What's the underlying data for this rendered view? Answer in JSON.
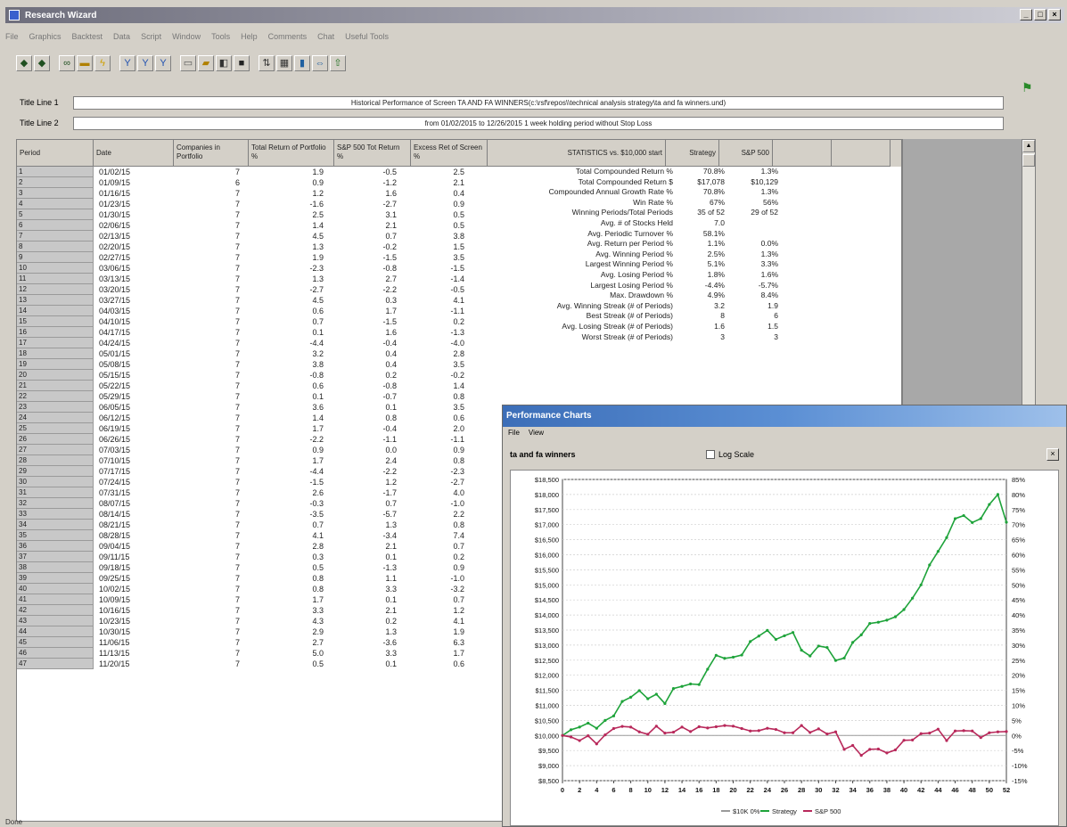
{
  "window": {
    "title": "Research Wizard",
    "min": "_",
    "max": "□",
    "close": "×"
  },
  "menu": [
    "File",
    "Graphics",
    "Backtest",
    "Data",
    "Script",
    "Window",
    "Tools",
    "Help",
    "Comments",
    "Chat",
    "Useful Tools"
  ],
  "toolbar_icons": [
    "back-icon",
    "forward-icon",
    "binoculars-icon",
    "minus-icon",
    "lightning-icon",
    "filter-icon",
    "filter-icon",
    "filter-icon",
    "new-icon",
    "open-icon",
    "preview-icon",
    "save-icon",
    "pivot-icon",
    "grid-icon",
    "chart-icon",
    "rows-icon",
    "export-icon"
  ],
  "title_line_1": {
    "label": "Title Line 1",
    "value": "Historical Performance of Screen TA AND FA WINNERS(c:\\rsf\\repos\\\\technical analysis strategy\\ta and fa winners.und)"
  },
  "title_line_2": {
    "label": "Title Line 2",
    "value": "from 01/02/2015 to 12/26/2015 1 week holding period without Stop Loss"
  },
  "grid_headers": [
    "Period",
    "Date",
    "Companies in Portfolio",
    "Total Return of Portfolio %",
    "S&P 500 Tot Return %",
    "Excess Ret of Screen %",
    "STATISTICS  vs. $10,000 start",
    "Strategy",
    "S&P 500"
  ],
  "rows": [
    [
      "1",
      "01/02/15",
      "7",
      "1.9",
      "-0.5",
      "2.5"
    ],
    [
      "2",
      "01/09/15",
      "6",
      "0.9",
      "-1.2",
      "2.1"
    ],
    [
      "3",
      "01/16/15",
      "7",
      "1.2",
      "1.6",
      "0.4"
    ],
    [
      "4",
      "01/23/15",
      "7",
      "-1.6",
      "-2.7",
      "0.9"
    ],
    [
      "5",
      "01/30/15",
      "7",
      "2.5",
      "3.1",
      "0.5"
    ],
    [
      "6",
      "02/06/15",
      "7",
      "1.4",
      "2.1",
      "0.5"
    ],
    [
      "7",
      "02/13/15",
      "7",
      "4.5",
      "0.7",
      "3.8"
    ],
    [
      "8",
      "02/20/15",
      "7",
      "1.3",
      "-0.2",
      "1.5"
    ],
    [
      "9",
      "02/27/15",
      "7",
      "1.9",
      "-1.5",
      "3.5"
    ],
    [
      "10",
      "03/06/15",
      "7",
      "-2.3",
      "-0.8",
      "-1.5"
    ],
    [
      "11",
      "03/13/15",
      "7",
      "1.3",
      "2.7",
      "-1.4"
    ],
    [
      "12",
      "03/20/15",
      "7",
      "-2.7",
      "-2.2",
      "-0.5"
    ],
    [
      "13",
      "03/27/15",
      "7",
      "4.5",
      "0.3",
      "4.1"
    ],
    [
      "14",
      "04/03/15",
      "7",
      "0.6",
      "1.7",
      "-1.1"
    ],
    [
      "15",
      "04/10/15",
      "7",
      "0.7",
      "-1.5",
      "0.2"
    ],
    [
      "16",
      "04/17/15",
      "7",
      "0.1",
      "1.6",
      "-1.3"
    ],
    [
      "17",
      "04/24/15",
      "7",
      "-4.4",
      "-0.4",
      "-4.0"
    ],
    [
      "18",
      "05/01/15",
      "7",
      "3.2",
      "0.4",
      "2.8"
    ],
    [
      "19",
      "05/08/15",
      "7",
      "3.8",
      "0.4",
      "3.5"
    ],
    [
      "20",
      "05/15/15",
      "7",
      "-0.8",
      "0.2",
      "-0.2"
    ],
    [
      "21",
      "05/22/15",
      "7",
      "0.6",
      "-0.8",
      "1.4"
    ],
    [
      "22",
      "05/29/15",
      "7",
      "0.1",
      "-0.7",
      "0.8"
    ],
    [
      "23",
      "06/05/15",
      "7",
      "3.6",
      "0.1",
      "3.5"
    ],
    [
      "24",
      "06/12/15",
      "7",
      "1.4",
      "0.8",
      "0.6"
    ],
    [
      "25",
      "06/19/15",
      "7",
      "1.7",
      "-0.4",
      "2.0"
    ],
    [
      "26",
      "06/26/15",
      "7",
      "-2.2",
      "-1.1",
      "-1.1"
    ],
    [
      "27",
      "07/03/15",
      "7",
      "0.9",
      "0.0",
      "0.9"
    ],
    [
      "28",
      "07/10/15",
      "7",
      "1.7",
      "2.4",
      "0.8"
    ],
    [
      "29",
      "07/17/15",
      "7",
      "-4.4",
      "-2.2",
      "-2.3"
    ],
    [
      "30",
      "07/24/15",
      "7",
      "-1.5",
      "1.2",
      "-2.7"
    ],
    [
      "31",
      "07/31/15",
      "7",
      "2.6",
      "-1.7",
      "4.0"
    ],
    [
      "32",
      "08/07/15",
      "7",
      "-0.3",
      "0.7",
      "-1.0"
    ],
    [
      "33",
      "08/14/15",
      "7",
      "-3.5",
      "-5.7",
      "2.2"
    ],
    [
      "34",
      "08/21/15",
      "7",
      "0.7",
      "1.3",
      "0.8"
    ],
    [
      "35",
      "08/28/15",
      "7",
      "4.1",
      "-3.4",
      "7.4"
    ],
    [
      "36",
      "09/04/15",
      "7",
      "2.8",
      "2.1",
      "0.7"
    ],
    [
      "37",
      "09/11/15",
      "7",
      "0.3",
      "0.1",
      "0.2"
    ],
    [
      "38",
      "09/18/15",
      "7",
      "0.5",
      "-1.3",
      "0.9"
    ],
    [
      "39",
      "09/25/15",
      "7",
      "0.8",
      "1.1",
      "-1.0"
    ],
    [
      "40",
      "10/02/15",
      "7",
      "0.8",
      "3.3",
      "-3.2"
    ],
    [
      "41",
      "10/09/15",
      "7",
      "1.7",
      "0.1",
      "0.7"
    ],
    [
      "42",
      "10/16/15",
      "7",
      "3.3",
      "2.1",
      "1.2"
    ],
    [
      "43",
      "10/23/15",
      "7",
      "4.3",
      "0.2",
      "4.1"
    ],
    [
      "44",
      "10/30/15",
      "7",
      "2.9",
      "1.3",
      "1.9"
    ],
    [
      "45",
      "11/06/15",
      "7",
      "2.7",
      "-3.6",
      "6.3"
    ],
    [
      "46",
      "11/13/15",
      "7",
      "5.0",
      "3.3",
      "1.7"
    ],
    [
      "47",
      "11/20/15",
      "7",
      "0.5",
      "0.1",
      "0.6"
    ]
  ],
  "stats": [
    {
      "label": "Total Compounded Return %",
      "strategy": "70.8%",
      "sp": "1.3%"
    },
    {
      "label": "Total Compounded Return $",
      "strategy": "$17,078",
      "sp": "$10,129"
    },
    {
      "label": "Compounded Annual Growth Rate %",
      "strategy": "70.8%",
      "sp": "1.3%"
    },
    {
      "label": "Win Rate %",
      "strategy": "67%",
      "sp": "56%"
    },
    {
      "label": "Winning Periods/Total Periods",
      "strategy": "35 of 52",
      "sp": "29 of 52"
    },
    {
      "label": "Avg. # of Stocks Held",
      "strategy": "7.0",
      "sp": ""
    },
    {
      "label": "Avg. Periodic Turnover %",
      "strategy": "58.1%",
      "sp": ""
    },
    {
      "label": "Avg. Return per Period %",
      "strategy": "1.1%",
      "sp": "0.0%"
    },
    {
      "label": "Avg. Winning Period %",
      "strategy": "2.5%",
      "sp": "1.3%"
    },
    {
      "label": "Largest Winning Period %",
      "strategy": "5.1%",
      "sp": "3.3%"
    },
    {
      "label": "Avg. Losing Period %",
      "strategy": "1.8%",
      "sp": "1.6%"
    },
    {
      "label": "Largest Losing Period %",
      "strategy": "-4.4%",
      "sp": "-5.7%"
    },
    {
      "label": "Max. Drawdown %",
      "strategy": "4.9%",
      "sp": "8.4%"
    },
    {
      "label": "Avg. Winning Streak (# of Periods)",
      "strategy": "3.2",
      "sp": "1.9"
    },
    {
      "label": "Best Streak (# of Periods)",
      "strategy": "8",
      "sp": "6"
    },
    {
      "label": "Avg. Losing Streak (# of Periods)",
      "strategy": "1.6",
      "sp": "1.5"
    },
    {
      "label": "Worst Streak (# of Periods)",
      "strategy": "3",
      "sp": "3"
    }
  ],
  "status_text": "Done",
  "perf_window": {
    "title": "Performance Charts",
    "menu": [
      "File",
      "View"
    ],
    "heading": "ta and fa winners",
    "logscale_label": "Log Scale"
  },
  "chart_data": {
    "type": "line",
    "x": [
      0,
      1,
      2,
      3,
      4,
      5,
      6,
      7,
      8,
      9,
      10,
      11,
      12,
      13,
      14,
      15,
      16,
      17,
      18,
      19,
      20,
      21,
      22,
      23,
      24,
      25,
      26,
      27,
      28,
      29,
      30,
      31,
      32,
      33,
      34,
      35,
      36,
      37,
      38,
      39,
      40,
      41,
      42,
      43,
      44,
      45,
      46,
      47,
      48,
      49,
      50,
      51,
      52
    ],
    "x_ticks": [
      "0",
      "2",
      "4",
      "6",
      "8",
      "10",
      "12",
      "14",
      "16",
      "18",
      "20",
      "22",
      "24",
      "26",
      "28",
      "30",
      "32",
      "34",
      "36",
      "38",
      "40",
      "42",
      "44",
      "46",
      "48",
      "50",
      "52"
    ],
    "ylim": [
      8500,
      18500
    ],
    "y_ticks_left": [
      "$8,500",
      "$9,000",
      "$9,500",
      "$10,000",
      "$10,500",
      "$11,000",
      "$11,500",
      "$12,000",
      "$12,500",
      "$13,000",
      "$13,500",
      "$14,000",
      "$14,500",
      "$15,000",
      "$15,500",
      "$16,000",
      "$16,500",
      "$17,000",
      "$17,500",
      "$18,000",
      "$18,500"
    ],
    "y_ticks_right": [
      "-15%",
      "-10%",
      "-5%",
      "0%",
      "5%",
      "10%",
      "15%",
      "20%",
      "25%",
      "30%",
      "35%",
      "40%",
      "45%",
      "50%",
      "55%",
      "60%",
      "65%",
      "70%",
      "75%",
      "80%",
      "85%"
    ],
    "series": [
      {
        "name": "$10K 0%",
        "color": "#9a9a9a",
        "values": [
          10000,
          10000,
          10000,
          10000,
          10000,
          10000,
          10000,
          10000,
          10000,
          10000,
          10000,
          10000,
          10000,
          10000,
          10000,
          10000,
          10000,
          10000,
          10000,
          10000,
          10000,
          10000,
          10000,
          10000,
          10000,
          10000,
          10000,
          10000,
          10000,
          10000,
          10000,
          10000,
          10000,
          10000,
          10000,
          10000,
          10000,
          10000,
          10000,
          10000,
          10000,
          10000,
          10000,
          10000,
          10000,
          10000,
          10000,
          10000,
          10000,
          10000,
          10000,
          10000,
          10000
        ]
      },
      {
        "name": "Strategy",
        "color": "#1ea33a",
        "values": [
          10000,
          10190,
          10280,
          10410,
          10240,
          10500,
          10650,
          11130,
          11270,
          11490,
          11220,
          11370,
          11060,
          11560,
          11630,
          11710,
          11690,
          12200,
          12660,
          12560,
          12600,
          12670,
          13120,
          13300,
          13490,
          13190,
          13310,
          13420,
          12830,
          12640,
          12970,
          12920,
          12490,
          12570,
          13090,
          13340,
          13720,
          13760,
          13830,
          13940,
          14180,
          14560,
          15000,
          15660,
          16110,
          16570,
          17200,
          17300,
          17070,
          17200,
          17670,
          18000,
          17080
        ]
      },
      {
        "name": "S&P 500",
        "color": "#b8285a",
        "values": [
          10000,
          9950,
          9830,
          9990,
          9720,
          10020,
          10230,
          10300,
          10280,
          10120,
          10040,
          10310,
          10080,
          10110,
          10280,
          10130,
          10290,
          10250,
          10290,
          10330,
          10310,
          10230,
          10150,
          10160,
          10240,
          10200,
          10090,
          10090,
          10330,
          10100,
          10220,
          10050,
          10120,
          9540,
          9670,
          9340,
          9540,
          9550,
          9420,
          9520,
          9840,
          9850,
          10060,
          10080,
          10210,
          9830,
          10150,
          10160,
          10150,
          9930,
          10090,
          10120,
          10130
        ]
      }
    ]
  }
}
